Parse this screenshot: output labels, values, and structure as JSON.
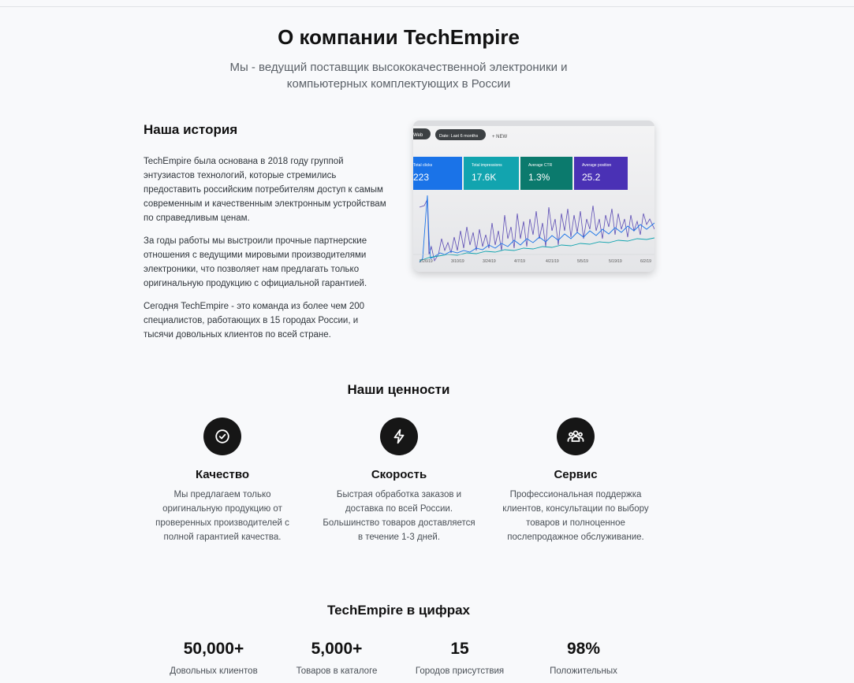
{
  "header": {
    "title": "О компании TechEmpire",
    "subtitle": "Мы - ведущий поставщик высококачественной электроники и компьютерных комплектующих в России"
  },
  "story": {
    "title": "Наша история",
    "paragraphs": [
      "TechEmpire была основана в 2018 году группой энтузиастов технологий, которые стремились предоставить российским потребителям доступ к самым современным и качественным электронным устройствам по справедливым ценам.",
      "За годы работы мы выстроили прочные партнерские отношения с ведущими мировыми производителями электроники, что позволяет нам предлагать только оригинальную продукцию с официальной гарантией.",
      "Сегодня TechEmpire - это команда из более чем 200 специалистов, работающих в 15 городах России, и тысячи довольных клиентов по всей стране."
    ],
    "image": {
      "chips": [
        "Web",
        "Date: Last 6 months",
        "+ NEW"
      ],
      "metrics": [
        {
          "label": "Total clicks",
          "value": "223",
          "color": "#1a73e8"
        },
        {
          "label": "Total impressions",
          "value": "17.6K",
          "color": "#12a4af"
        },
        {
          "label": "Average CTR",
          "value": "1.3%",
          "color": "#0b7a6d"
        },
        {
          "label": "Average position",
          "value": "25.2",
          "color": "#4a31b5"
        }
      ],
      "dates": [
        "2/26/19",
        "3/10/19",
        "3/24/19",
        "4/7/19",
        "4/21/19",
        "5/5/19",
        "5/19/19",
        "6/2/19"
      ]
    }
  },
  "values": {
    "title": "Наши ценности",
    "items": [
      {
        "icon": "check-circle-icon",
        "name": "Качество",
        "desc": "Мы предлагаем только оригинальную продукцию от проверенных производителей с полной гарантией качества."
      },
      {
        "icon": "lightning-icon",
        "name": "Скорость",
        "desc": "Быстрая обработка заказов и доставка по всей России. Большинство товаров доставляется в течение 1-3 дней."
      },
      {
        "icon": "users-icon",
        "name": "Сервис",
        "desc": "Профессиональная поддержка клиентов, консультации по выбору товаров и полноценное послепродажное обслуживание."
      }
    ]
  },
  "numbers": {
    "title": "TechEmpire в цифрах",
    "items": [
      {
        "value": "50,000+",
        "label": "Довольных клиентов"
      },
      {
        "value": "5,000+",
        "label": "Товаров в каталоге"
      },
      {
        "value": "15",
        "label": "Городов присутствия"
      },
      {
        "value": "98%",
        "label": "Положительных"
      }
    ]
  }
}
